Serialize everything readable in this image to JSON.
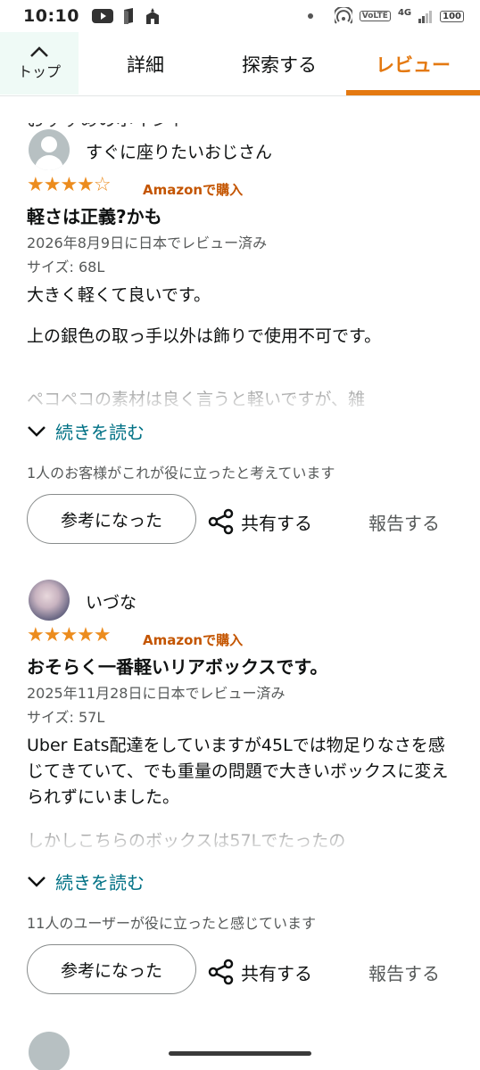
{
  "status_bar": {
    "time": "10:10",
    "network": "4G",
    "volte": "VoLTE",
    "battery": "100"
  },
  "tabs": {
    "top_label": "トップ",
    "items": [
      {
        "label": "詳細",
        "active": false
      },
      {
        "label": "探索する",
        "active": false
      },
      {
        "label": "レビュー",
        "active": true
      }
    ],
    "accent_color": "#e47911"
  },
  "reviews": [
    {
      "reviewer": "すぐに座りたいおじさん",
      "rating": 4,
      "stars": "★★★★☆",
      "verified": "Amazonで購入",
      "title": "軽さは正義?かも",
      "date": "2026年8月9日に日本でレビュー済み",
      "size": "サイズ: 68L",
      "paragraphs": [
        "大きく軽くて良いです。",
        "上の銀色の取っ手以外は飾りで使用不可です。"
      ],
      "faded": "ペコペコの素材は良く言うと軽いですが、雑",
      "read_more": "続きを読む",
      "helpful_text": "1人のお客様がこれが役に立ったと考えています",
      "helpful_button": "参考になった",
      "share": "共有する",
      "report": "報告する"
    },
    {
      "reviewer": "いづな",
      "rating": 5,
      "stars": "★★★★★",
      "verified": "Amazonで購入",
      "title": "おそらく一番軽いリアボックスです。",
      "date": "2025年11月28日に日本でレビュー済み",
      "size": "サイズ: 57L",
      "paragraphs": [
        "Uber Eats配達をしていますが45Lでは物足りなさを感じてきていて、でも重量の問題で大きいボックスに変えられずにいました。"
      ],
      "faded": "しかしこちらのボックスは57Lでたったの",
      "read_more": "続きを読む",
      "helpful_text": "11人のユーザーが役に立ったと感じています",
      "helpful_button": "参考になった",
      "share": "共有する",
      "report": "報告する"
    }
  ]
}
